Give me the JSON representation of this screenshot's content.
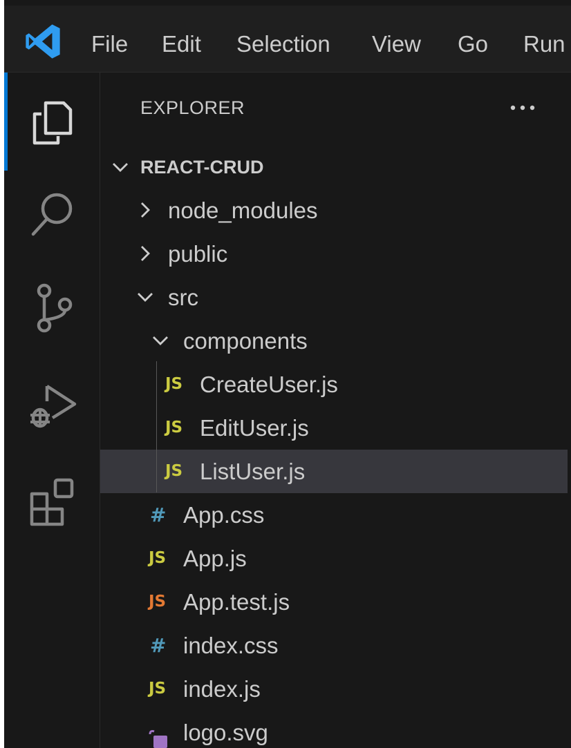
{
  "menu": {
    "items": [
      "File",
      "Edit",
      "Selection",
      "View",
      "Go",
      "Run"
    ]
  },
  "activity_bar": {
    "icons": [
      "explorer-icon",
      "search-icon",
      "source-control-icon",
      "run-debug-icon",
      "extensions-icon"
    ],
    "active": "explorer-icon",
    "accent_color": "#0078d4"
  },
  "explorer": {
    "title": "EXPLORER",
    "more_actions": "···",
    "root": {
      "label": "REACT-CRUD",
      "expanded": true
    },
    "items": [
      {
        "label": "node_modules",
        "type": "folder",
        "expanded": false
      },
      {
        "label": "public",
        "type": "folder",
        "expanded": false
      },
      {
        "label": "src",
        "type": "folder",
        "expanded": true
      },
      {
        "label": "components",
        "type": "folder",
        "expanded": true
      },
      {
        "label": "CreateUser.js",
        "type": "js",
        "icon": "JS"
      },
      {
        "label": "EditUser.js",
        "type": "js",
        "icon": "JS"
      },
      {
        "label": "ListUser.js",
        "type": "js",
        "icon": "JS",
        "selected": true
      },
      {
        "label": "App.css",
        "type": "css",
        "icon": "#"
      },
      {
        "label": "App.js",
        "type": "js",
        "icon": "JS"
      },
      {
        "label": "App.test.js",
        "type": "test",
        "icon": "JS"
      },
      {
        "label": "index.css",
        "type": "css",
        "icon": "#"
      },
      {
        "label": "index.js",
        "type": "js",
        "icon": "JS"
      },
      {
        "label": "logo.svg",
        "type": "svg"
      }
    ]
  },
  "colors": {
    "js_icon": "#cbcb41",
    "test_icon": "#e37933",
    "css_icon": "#519aba",
    "svg_icon": "#a074c4",
    "selection": "#37373d"
  }
}
